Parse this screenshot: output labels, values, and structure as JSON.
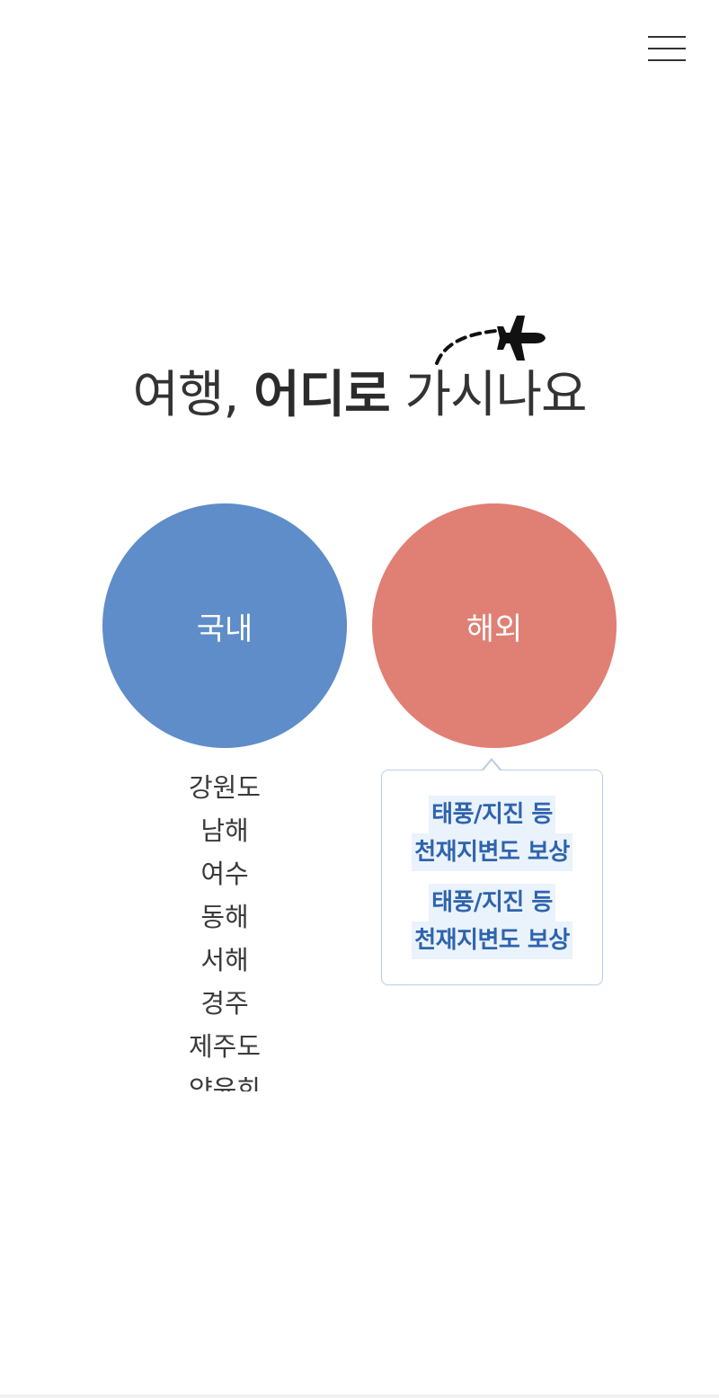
{
  "header": {
    "menu_icon": "hamburger-menu-icon"
  },
  "headline": {
    "part1": "여행, ",
    "part2_bold": "어디로",
    "part3": " 가시나요",
    "decoration_icon": "airplane-icon"
  },
  "circles": {
    "domestic_label": "국내",
    "overseas_label": "해외",
    "domestic_color": "#5e8dc9",
    "overseas_color": "#e07f74"
  },
  "domestic_destinations": [
    "강원도",
    "남해",
    "여수",
    "동해",
    "서해",
    "경주",
    "제주도",
    "양윤희"
  ],
  "tooltip": {
    "line1": "태풍/지진 등",
    "line2": "천재지변도 보상",
    "line1_repeat": "태풍/지진 등",
    "line2_repeat": "천재지변도 보상",
    "text_color": "#2e64ad"
  }
}
